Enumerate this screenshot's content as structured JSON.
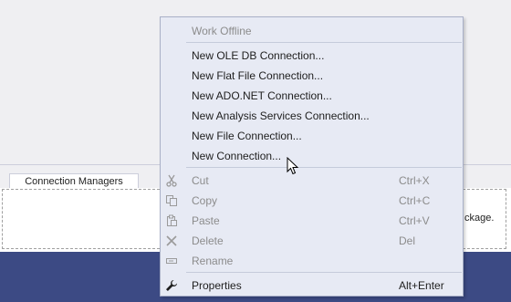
{
  "background": {
    "connection_managers_tab": "Connection Managers",
    "hint_text_fragment": "ckage."
  },
  "context_menu": {
    "work_offline": "Work Offline",
    "connection_items": [
      "New OLE DB Connection...",
      "New Flat File Connection...",
      "New ADO.NET Connection...",
      "New Analysis Services Connection...",
      "New File Connection...",
      "New Connection..."
    ],
    "edit_items": [
      {
        "label": "Cut",
        "shortcut": "Ctrl+X",
        "icon": "scissors-icon",
        "enabled": false
      },
      {
        "label": "Copy",
        "shortcut": "Ctrl+C",
        "icon": "copy-icon",
        "enabled": false
      },
      {
        "label": "Paste",
        "shortcut": "Ctrl+V",
        "icon": "paste-icon",
        "enabled": false
      },
      {
        "label": "Delete",
        "shortcut": "Del",
        "icon": "delete-x-icon",
        "enabled": false
      },
      {
        "label": "Rename",
        "shortcut": "",
        "icon": "rename-icon",
        "enabled": false
      }
    ],
    "properties": {
      "label": "Properties",
      "shortcut": "Alt+Enter",
      "icon": "wrench-icon",
      "enabled": true
    }
  },
  "colors": {
    "menu_background": "#e7eaf4",
    "status_bar": "#3c4a84",
    "disabled_text": "#8c8c8c"
  }
}
